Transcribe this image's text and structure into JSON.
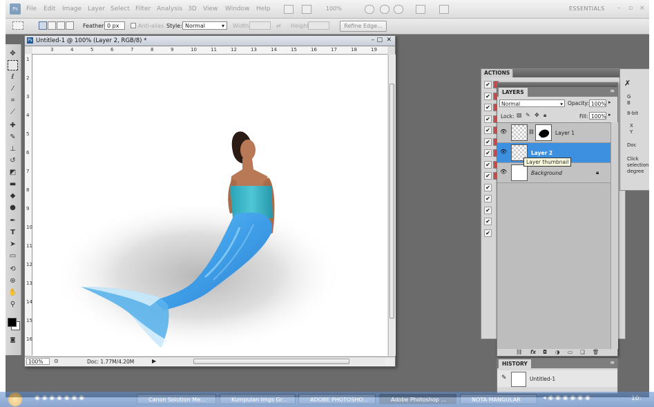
{
  "menu": [
    "File",
    "Edit",
    "Image",
    "Layer",
    "Select",
    "Filter",
    "Analysis",
    "3D",
    "View",
    "Window",
    "Help"
  ],
  "menubar": {
    "zoom": "100%",
    "workspace": "ESSENTIALS",
    "window_controls": [
      "–",
      "▫",
      "×"
    ]
  },
  "options": {
    "feather_label": "Feather:",
    "feather_value": "0 px",
    "antialias_label": "Anti-alias",
    "style_label": "Style:",
    "style_value": "Normal",
    "width_label": "Width:",
    "height_label": "Height:",
    "refine_edge": "Refine Edge..."
  },
  "tools": [
    "move-icon",
    "marquee-icon",
    "lasso-icon",
    "quick-select-icon",
    "crop-icon",
    "eyedropper-icon",
    "healing-icon",
    "brush-icon",
    "stamp-icon",
    "history-brush-icon",
    "eraser-icon",
    "gradient-icon",
    "blur-icon",
    "dodge-icon",
    "pen-icon",
    "type-icon",
    "path-select-icon",
    "shape-icon",
    "3d-rotate-icon",
    "3d-orbit-icon",
    "hand-icon",
    "zoom-icon"
  ],
  "document": {
    "title": "Untitled-1 @ 100% (Layer 2, RGB/8) *",
    "ruler_h": [
      "3",
      "4",
      "5",
      "6",
      "7",
      "8",
      "9",
      "10",
      "11",
      "12",
      "13",
      "14",
      "15",
      "16",
      "17",
      "18",
      "19"
    ],
    "ruler_v": [
      "1",
      "2",
      "3",
      "4",
      "5",
      "6",
      "7",
      "8",
      "9",
      "10",
      "11",
      "12",
      "13",
      "14",
      "15",
      "16"
    ],
    "zoom": "100%",
    "doc_info": "Doc: 1.77M/4.20M"
  },
  "actions_panel": {
    "tab": "ACTIONS",
    "rows": 14
  },
  "far_panel": {
    "items": [
      "G",
      "B",
      "8-bit",
      "X",
      "Y",
      "Doc",
      "Click",
      "selection",
      "degree"
    ]
  },
  "layers": {
    "tab": "LAYERS",
    "blend_mode": "Normal",
    "opacity_label": "Opacity:",
    "opacity_value": "100%",
    "lock_label": "Lock:",
    "fill_label": "Fill:",
    "fill_value": "100%",
    "rows": [
      {
        "name": "Layer 1"
      },
      {
        "name": "Layer 2"
      },
      {
        "name": "Background"
      }
    ],
    "tooltip": "Layer thumbnail"
  },
  "history": {
    "tab": "HISTORY",
    "item": "Untitled-1"
  },
  "taskbar": {
    "buttons": [
      "Canon Solution Me...",
      "Kumpulan Imgs Gr...",
      "ADOBE PHOTOSHO...",
      "Adobe Photoshop ...",
      "NOTA MANGULAR"
    ],
    "clock": "10:"
  },
  "colors": {
    "selected_layer": "#3d8fe0",
    "workspace_bg": "#6b6b6b",
    "tail": "#3f9ee8",
    "top": "#3ab1c5"
  }
}
